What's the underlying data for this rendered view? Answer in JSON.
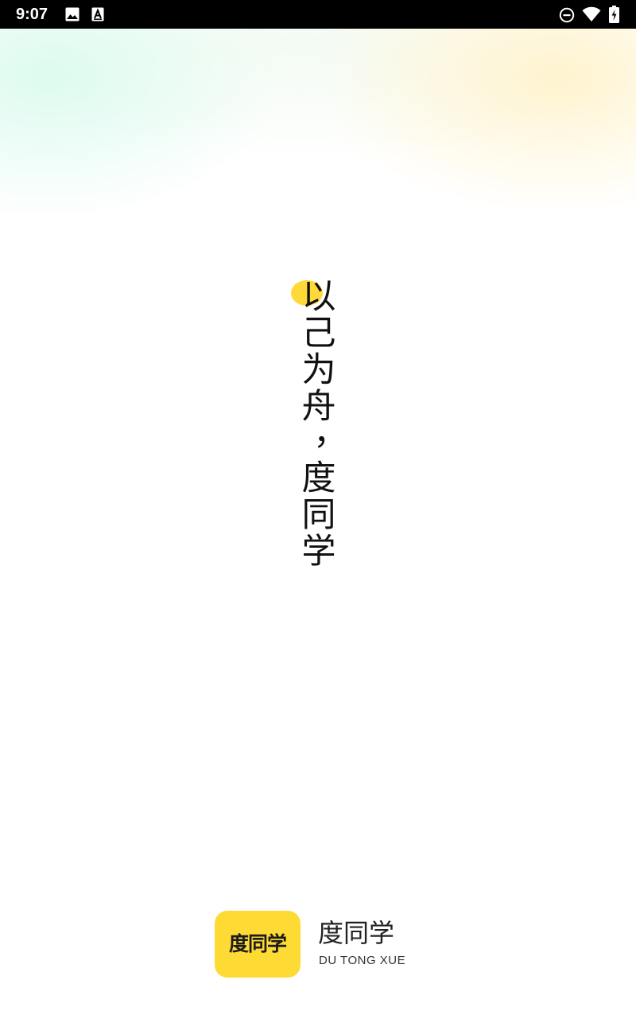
{
  "status_bar": {
    "time": "9:07",
    "left_icons": [
      "image-icon",
      "text-a-icon"
    ],
    "right_icons": [
      "do-not-disturb-icon",
      "wifi-icon",
      "battery-charging-icon"
    ]
  },
  "slogan": {
    "chars": [
      "以",
      "己",
      "为",
      "舟",
      "，",
      "度",
      "同",
      "学"
    ],
    "accent_color": "#ffd93a"
  },
  "brand": {
    "logo_text": "度同学",
    "name": "度同学",
    "subtitle": "DU TONG XUE",
    "logo_color": "#fedb34"
  }
}
